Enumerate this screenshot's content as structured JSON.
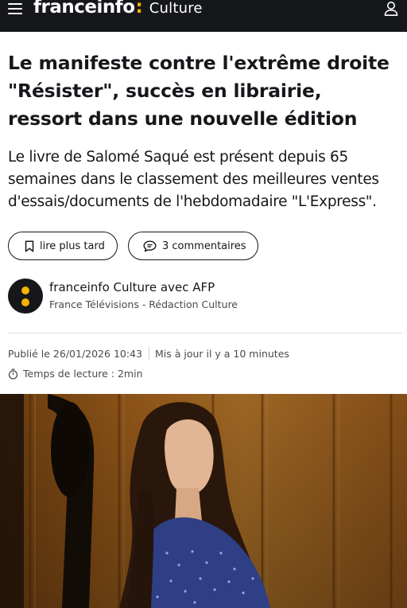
{
  "header": {
    "brand_name": "franceinfo",
    "brand_colon": ":",
    "section": "Culture",
    "menu_icon": "hamburger-menu-icon",
    "user_icon": "user-account-icon"
  },
  "article": {
    "title": "Le manifeste contre l'extrême droite \"Résister\", succès en librairie, ressort dans une nouvelle édition",
    "lead": "Le livre de Salomé Saqué est présent depuis 65 semaines dans le classement des meilleures ventes d'essais/documents de l'hebdomadaire \"L'Express\".",
    "actions": {
      "read_later_label": "lire plus tard",
      "comments_label": "3 commentaires"
    },
    "author": {
      "name": "franceinfo Culture avec AFP",
      "organization": "France Télévisions - Rédaction Culture"
    },
    "published": "Publié le 26/01/2026 10:43",
    "updated": "Mis à jour il y a 10 minutes",
    "reading_time": "Temps de lecture : 2min"
  },
  "colors": {
    "header_bg": "#15171a",
    "brand_accent": "#f4b400",
    "text": "#15171a",
    "muted": "#4a4a4a"
  }
}
